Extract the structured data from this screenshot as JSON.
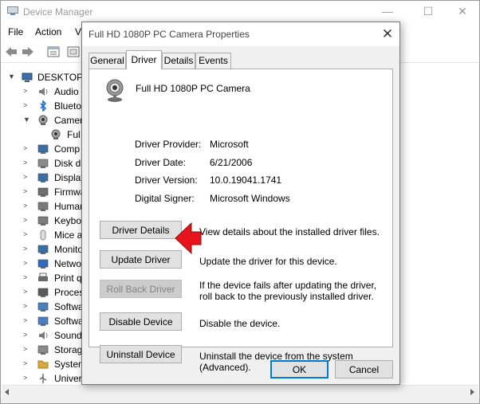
{
  "device_manager": {
    "title": "Device Manager",
    "menu": [
      "File",
      "Action",
      "V"
    ],
    "tree": {
      "root": "DESKTOP-",
      "items": [
        {
          "label": "Audio",
          "arrow": "right",
          "icon": "speaker-icon"
        },
        {
          "label": "Blueto",
          "arrow": "right",
          "icon": "bluetooth-icon"
        },
        {
          "label": "Camer",
          "arrow": "down",
          "icon": "camera-icon"
        },
        {
          "label": "Ful",
          "arrow": "none",
          "icon": "camera-icon",
          "child": true
        },
        {
          "label": "Comp",
          "arrow": "right",
          "icon": "monitor-icon"
        },
        {
          "label": "Disk d",
          "arrow": "right",
          "icon": "disk-icon"
        },
        {
          "label": "Display",
          "arrow": "right",
          "icon": "monitor-icon"
        },
        {
          "label": "Firmwa",
          "arrow": "right",
          "icon": "firmware-icon"
        },
        {
          "label": "Human",
          "arrow": "right",
          "icon": "hid-icon"
        },
        {
          "label": "Keybo",
          "arrow": "right",
          "icon": "keyboard-icon"
        },
        {
          "label": "Mice a",
          "arrow": "right",
          "icon": "mouse-icon"
        },
        {
          "label": "Monito",
          "arrow": "right",
          "icon": "monitor-icon"
        },
        {
          "label": "Netwo",
          "arrow": "right",
          "icon": "network-icon"
        },
        {
          "label": "Print q",
          "arrow": "right",
          "icon": "printer-icon"
        },
        {
          "label": "Proces",
          "arrow": "right",
          "icon": "processor-icon"
        },
        {
          "label": "Softwa",
          "arrow": "right",
          "icon": "software-icon"
        },
        {
          "label": "Softwa",
          "arrow": "right",
          "icon": "software-icon"
        },
        {
          "label": "Sound",
          "arrow": "right",
          "icon": "speaker-icon"
        },
        {
          "label": "Storag",
          "arrow": "right",
          "icon": "storage-icon"
        },
        {
          "label": "System",
          "arrow": "right",
          "icon": "folder-icon"
        },
        {
          "label": "Univer",
          "arrow": "right",
          "icon": "usb-icon"
        }
      ]
    }
  },
  "dialog": {
    "title": "Full HD 1080P PC Camera Properties",
    "close": "✕",
    "tabs": [
      "General",
      "Driver",
      "Details",
      "Events"
    ],
    "active_tab": "Driver",
    "device_name": "Full HD 1080P PC Camera",
    "properties": [
      {
        "label": "Driver Provider:",
        "value": "Microsoft"
      },
      {
        "label": "Driver Date:",
        "value": "6/21/2006"
      },
      {
        "label": "Driver Version:",
        "value": "10.0.19041.1741"
      },
      {
        "label": "Digital Signer:",
        "value": "Microsoft Windows"
      }
    ],
    "actions": [
      {
        "label": "Driver Details",
        "description": "View details about the installed driver files.",
        "enabled": true
      },
      {
        "label": "Update Driver",
        "description": "Update the driver for this device.",
        "enabled": true
      },
      {
        "label": "Roll Back Driver",
        "description": "If the device fails after updating the driver, roll back to the previously installed driver.",
        "enabled": false
      },
      {
        "label": "Disable Device",
        "description": "Disable the device.",
        "enabled": true
      },
      {
        "label": "Uninstall Device",
        "description": "Uninstall the device from the system (Advanced).",
        "enabled": true
      }
    ],
    "ok": "OK",
    "cancel": "Cancel"
  },
  "colors": {
    "annotation_arrow": "#e8141b",
    "focus_border": "#0078d7",
    "bluetooth": "#1e6fd9"
  }
}
